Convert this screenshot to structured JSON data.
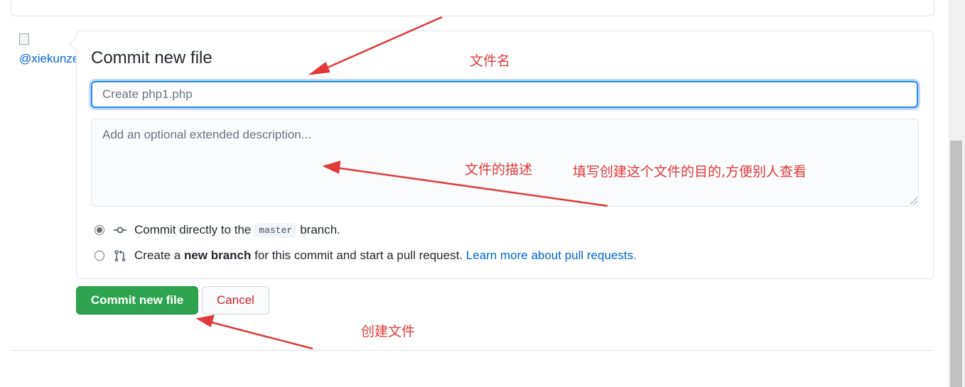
{
  "avatar": {
    "alt": "@xiekunze"
  },
  "form": {
    "title": "Commit new file",
    "summary_placeholder": "Create php1.php",
    "description_placeholder": "Add an optional extended description...",
    "options": {
      "direct": {
        "prefix": "Commit directly to the",
        "branch": "master",
        "suffix": "branch.",
        "checked": true
      },
      "new_branch": {
        "prefix": "Create a",
        "emphasis": "new branch",
        "suffix": "for this commit and start a pull request.",
        "link": "Learn more about pull requests.",
        "checked": false
      }
    },
    "commit_button": "Commit new file",
    "cancel_button": "Cancel"
  },
  "annotations": {
    "filename": "文件名",
    "description": "文件的描述",
    "purpose": "填写创建这个文件的目的,方便别人查看",
    "create": "创建文件",
    "color": "#e03a3a"
  },
  "colors": {
    "primary_button": "#2ea44f",
    "cancel_text": "#cb2431",
    "link": "#0366d6",
    "focus_border": "#2188ff"
  }
}
